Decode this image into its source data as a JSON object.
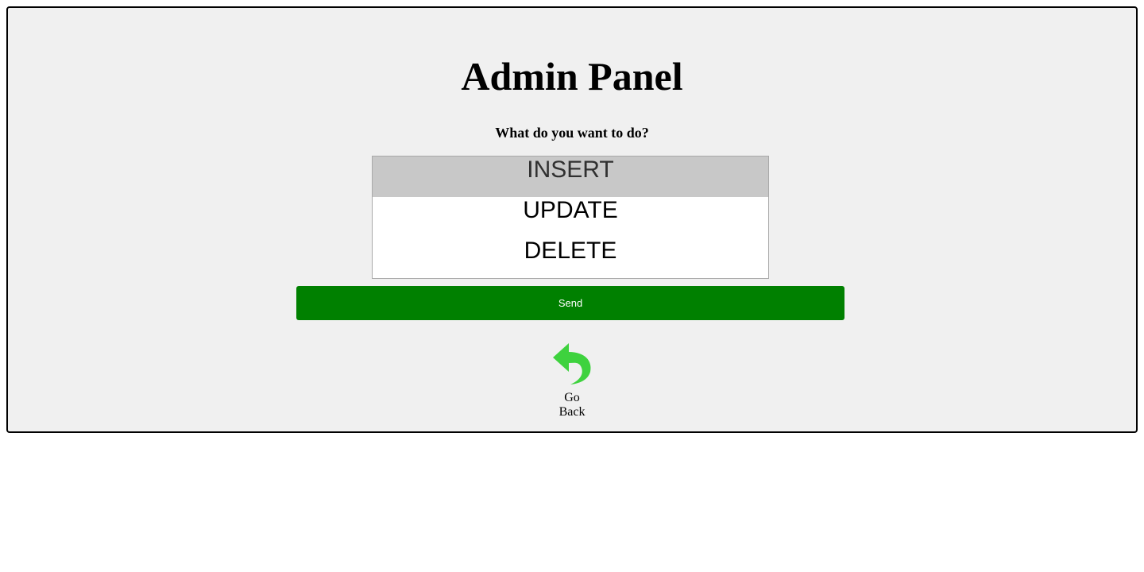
{
  "page": {
    "title": "Admin Panel",
    "question": "What do you want to do?"
  },
  "actions": {
    "options": [
      {
        "label": "INSERT",
        "selected": true
      },
      {
        "label": "UPDATE",
        "selected": false
      },
      {
        "label": "DELETE",
        "selected": false
      }
    ],
    "send_label": "Send"
  },
  "navigation": {
    "go_back_label": "Go Back",
    "go_back_icon": "back-arrow-icon"
  },
  "colors": {
    "panel_background": "#f0f0f0",
    "send_button": "#008000",
    "back_arrow": "#3ed23e",
    "selected_option": "#c8c8c8"
  }
}
